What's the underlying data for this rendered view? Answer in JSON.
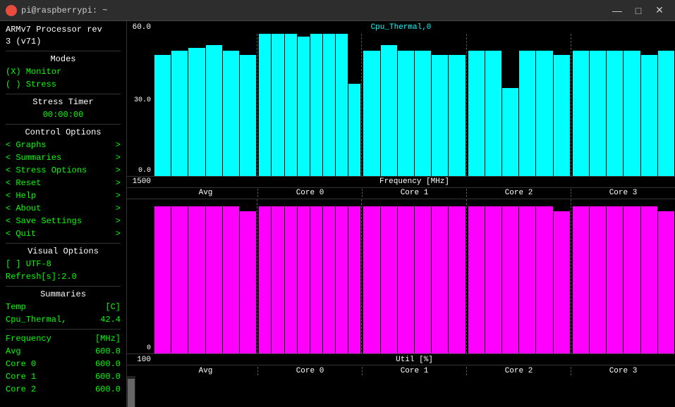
{
  "titlebar": {
    "title": "pi@raspberrypi: ~",
    "minimize_label": "—",
    "maximize_label": "□",
    "close_label": "✕"
  },
  "sidebar": {
    "processor_label": "ARMv7 Processor rev",
    "processor_model": "3 (v71)",
    "modes_title": "Modes",
    "monitor_option": "(X) Monitor",
    "stress_option": "( ) Stress",
    "stress_timer_title": "Stress Timer",
    "stress_timer_value": "00:00:00",
    "control_title": "Control Options",
    "menu_items": [
      {
        "label": "< Graphs",
        "arrow": ">"
      },
      {
        "label": "< Summaries",
        "arrow": ">"
      },
      {
        "label": "< Stress Options",
        "arrow": ">"
      },
      {
        "label": "< Reset",
        "arrow": ">"
      },
      {
        "label": "< Help",
        "arrow": ">"
      },
      {
        "label": "< About",
        "arrow": ">"
      },
      {
        "label": "< Save Settings",
        "arrow": ">"
      },
      {
        "label": "< Quit",
        "arrow": ">"
      }
    ],
    "visual_title": "Visual Options",
    "utf8_option": "[ ] UTF-8",
    "refresh_label": "Refresh[s]:2.0",
    "summaries_title": "Summaries",
    "temp_label": "Temp",
    "temp_unit": "[C]",
    "cpu_thermal_label": "Cpu_Thermal,",
    "cpu_thermal_value": "42.4",
    "frequency_label": "Frequency",
    "frequency_unit": "[MHz]",
    "avg_label": "Avg",
    "avg_value": "600.0",
    "core0_label": "Core 0",
    "core0_value": "600.0",
    "core1_label": "Core 1",
    "core1_value": "600.0",
    "core2_label": "Core 2",
    "core2_value": "600.0"
  },
  "freq_chart": {
    "title": "Cpu_Thermal,0",
    "y_top": "60.0",
    "y_mid": "30.0",
    "y_bot": "0.0",
    "section_label": "Frequency [MHz]",
    "y_val": "1500",
    "columns": [
      "Avg",
      "Core 0",
      "Core 1",
      "Core 2",
      "Core 3"
    ]
  },
  "util_chart": {
    "section_label": "Util [%]",
    "y_val": "100",
    "y_bot": "0",
    "columns": [
      "Avg",
      "Core 0",
      "Core 1",
      "Core 2",
      "Core 3"
    ]
  },
  "colors": {
    "cyan": "#00ffff",
    "magenta": "#ff00ff",
    "green": "#00ff00",
    "background": "#000000",
    "text_white": "#ffffff"
  }
}
